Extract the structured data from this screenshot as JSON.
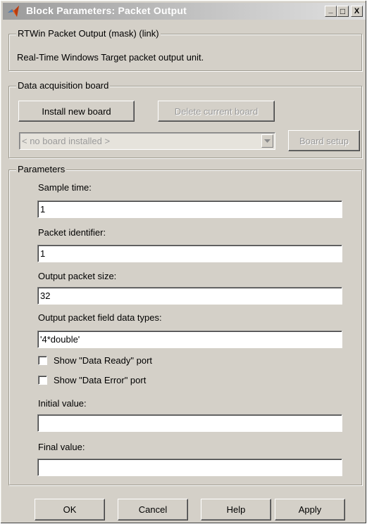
{
  "window": {
    "title": "Block Parameters: Packet Output",
    "controls": {
      "minimize": "_",
      "maximize": "□",
      "close": "X"
    }
  },
  "description_group": {
    "legend": "RTWin Packet Output (mask) (link)",
    "text": "Real-Time Windows Target packet output unit."
  },
  "daq_group": {
    "legend": "Data acquisition board",
    "install_label": "Install new board",
    "delete_label": "Delete current board",
    "board_select_value": "< no board installed >",
    "setup_label": "Board setup"
  },
  "parameters": {
    "legend": "Parameters",
    "sample_time": {
      "label": "Sample time:",
      "value": "1"
    },
    "packet_identifier": {
      "label": "Packet identifier:",
      "value": "1"
    },
    "output_packet_size": {
      "label": "Output packet size:",
      "value": "32"
    },
    "field_data_types": {
      "label": "Output packet field data types:",
      "value": "'4*double'"
    },
    "show_data_ready": {
      "label": "Show \"Data Ready\" port",
      "checked": false
    },
    "show_data_error": {
      "label": "Show \"Data Error\" port",
      "checked": false
    },
    "initial_value": {
      "label": "Initial value:",
      "value": ""
    },
    "final_value": {
      "label": "Final value:",
      "value": ""
    }
  },
  "footer": {
    "ok_label": "OK",
    "cancel_label": "Cancel",
    "help_label": "Help",
    "apply_label": "Apply"
  },
  "colors": {
    "dialog_bg": "#d4d0c8",
    "titlebar_inactive": "#9b9b9b",
    "disabled_text": "#9b9b9b"
  },
  "icons": {
    "app": "matlab-logo-icon",
    "dropdown": "chevron-down-icon"
  }
}
